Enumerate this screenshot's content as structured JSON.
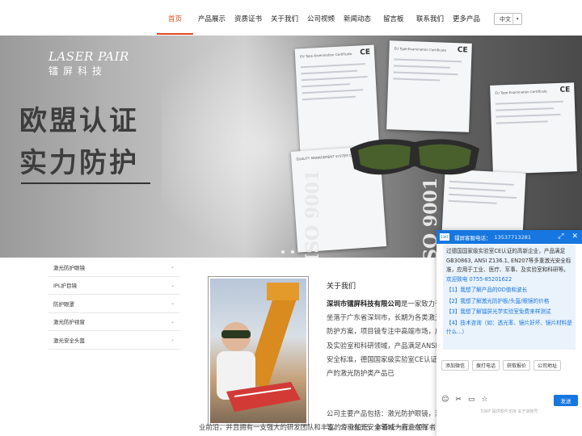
{
  "nav": {
    "items": [
      "首页",
      "产品展示",
      "资质证书",
      "关于我们",
      "公司视频",
      "新闻动态",
      "留言板",
      "联系我们",
      "更多产品"
    ],
    "active": "首页",
    "lang": "中文"
  },
  "banner": {
    "logo_en": "LASER PAIR",
    "logo_cn": "镭屏科技",
    "headline_1": "欧盟认证",
    "headline_2": "实力防护",
    "iso_1": "ISO 9001",
    "iso_2": "ISO 9001",
    "cert_title": "EU Type-Examination Certificate",
    "cert_title_2": "QUALITY MANAGEMENT SYSTEM CERTIFICATE",
    "cert_mark": "CE"
  },
  "sidebar": {
    "items": [
      "激光防护眼镜",
      "IPL护目镜",
      "防护眼罩",
      "激光防护视窗",
      "激光安全头盔"
    ]
  },
  "about": {
    "title": "关于我们",
    "company": "深圳市镭屏科技有限公司",
    "para1_rest": "是一家致力于激光安全防护的企业，公司坐落于广东省深圳市，长期为各类激光应用企业提供全方位的安全防护方案，项目镜专注中高端市场，广泛应用于医疗、军事激光，及实验室和科研领域，产品满足ANSI Z136.1, EN207等多重激光安全标准，德国国家级实验室CE认证并取得相关证书，自主研发生产的激光防护类产品已",
    "para2": "公司主要产品包括：激光防护眼镜，激光防护视窗，激光安全头盔等。公司在光安全领域一直走在行",
    "para3": "业前沿，并且拥有一支强大的研发团队和丰富的专业知识，本着成为行业领军者"
  },
  "chat": {
    "title": "镭屏客服电话：",
    "phone": "13537713281",
    "intro": "过德国国家级实验室CE认证的高新企业，产品满足GB30863, ANSI Z136.1, EN207等多重激光安全标准，应用于工业、医疗、军事、及实验室和科研等。",
    "welcome": "欢迎致电 0755-85201622",
    "options": [
      "【1】我想了解产品的OD值和波长",
      "【2】我想了解激光防护板/头盔/眼镜的价格",
      "【3】我想了解镭屏光学实验室免费来样测试",
      "【4】技术咨询（如：透光率、镜片好坏、镜片材料是什么...）"
    ],
    "quick": [
      "添加微信",
      "拨打电话",
      "获取报价",
      "公司地址"
    ],
    "send": "发送",
    "footer": "53KF 提供软件支持  关于该账号"
  }
}
